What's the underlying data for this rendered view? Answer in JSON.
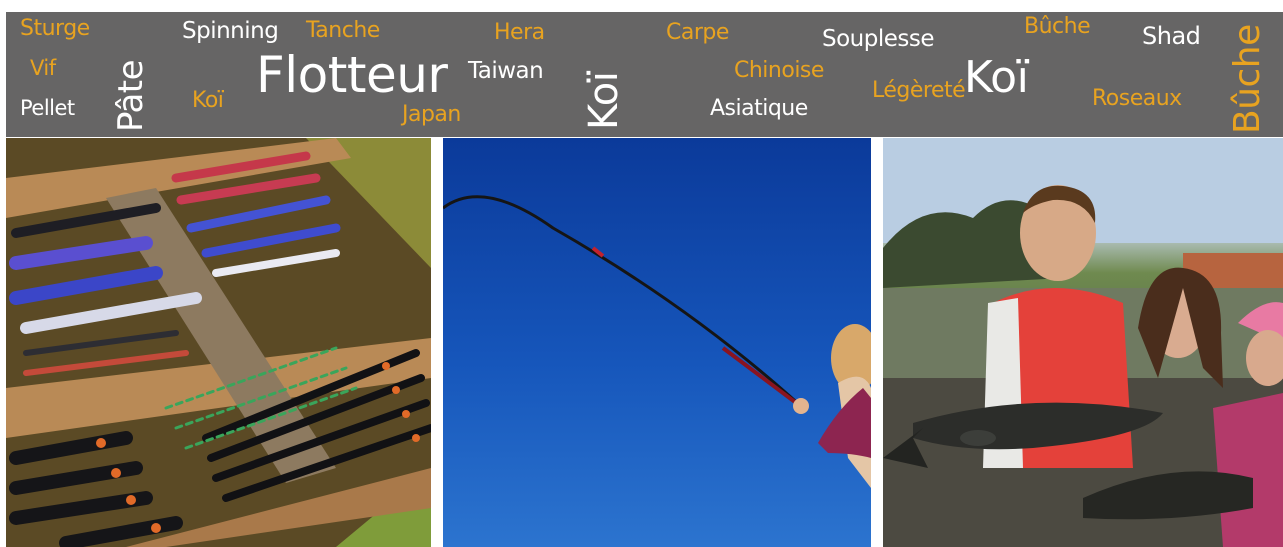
{
  "banner": {
    "words": [
      {
        "text": "Sturge"
      },
      {
        "text": "Vif"
      },
      {
        "text": "Pellet"
      },
      {
        "text": "Pâte"
      },
      {
        "text": "Spinning"
      },
      {
        "text": "Tanche"
      },
      {
        "text": "Koï"
      },
      {
        "text": "Flotteur"
      },
      {
        "text": "Hera"
      },
      {
        "text": "Taiwan"
      },
      {
        "text": "Japan"
      },
      {
        "text": "Koï"
      },
      {
        "text": "Carpe"
      },
      {
        "text": "Chinoise"
      },
      {
        "text": "Asiatique"
      },
      {
        "text": "Souplesse"
      },
      {
        "text": "Légèreté"
      },
      {
        "text": "Koï"
      },
      {
        "text": "Bûche"
      },
      {
        "text": "Shad"
      },
      {
        "text": "Roseaux"
      },
      {
        "text": "Bûche"
      }
    ],
    "colors": {
      "background": "#666565",
      "accent": "#e8a320",
      "light": "#ffffff"
    }
  },
  "photos": [
    {
      "subject": "box-of-fishing-floats"
    },
    {
      "subject": "person-holding-fishing-pole-against-blue-sky"
    },
    {
      "subject": "children-holding-caught-sturgeon"
    }
  ]
}
